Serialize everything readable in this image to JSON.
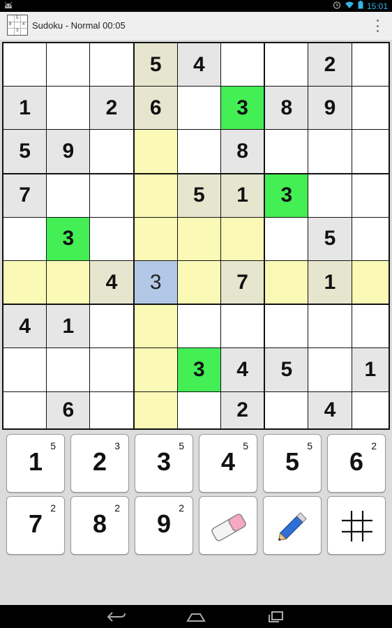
{
  "status_bar": {
    "time": "15:01",
    "icons": [
      "android-icon",
      "alarm-icon",
      "wifi-icon",
      "battery-icon"
    ]
  },
  "app_bar": {
    "title": "Sudoku  -  Normal   00:05",
    "icon_digits": [
      "5",
      "8",
      "4",
      "3"
    ]
  },
  "colors": {
    "white": "#ffffff",
    "given": "#e6e6e6",
    "highlight": "#fafab6",
    "highlight_given": "#e6e6cf",
    "match": "#44ee55",
    "selected": "#b3c8e6"
  },
  "board": {
    "rows": [
      [
        "",
        "",
        "",
        "5",
        "4",
        "",
        "",
        "2",
        ""
      ],
      [
        "1",
        "",
        "2",
        "6",
        "",
        "3",
        "8",
        "9",
        ""
      ],
      [
        "5",
        "9",
        "",
        "",
        "",
        "8",
        "",
        "",
        ""
      ],
      [
        "7",
        "",
        "",
        "",
        "5",
        "1",
        "3",
        "",
        ""
      ],
      [
        "",
        "3",
        "",
        "",
        "",
        "",
        "",
        "5",
        ""
      ],
      [
        "",
        "",
        "4",
        "3",
        "",
        "7",
        "",
        "1",
        ""
      ],
      [
        "4",
        "1",
        "",
        "",
        "",
        "",
        "",
        "",
        ""
      ],
      [
        "",
        "",
        "",
        "",
        "3",
        "4",
        "5",
        "",
        "1"
      ],
      [
        "",
        "6",
        "",
        "",
        "",
        "2",
        "",
        "4",
        ""
      ]
    ],
    "shades": [
      [
        "w",
        "w",
        "w",
        "hg",
        "g",
        "w",
        "w",
        "g",
        "w"
      ],
      [
        "g",
        "w",
        "g",
        "hg",
        "w",
        "m",
        "g",
        "g",
        "w"
      ],
      [
        "g",
        "g",
        "w",
        "h",
        "w",
        "g",
        "w",
        "w",
        "w"
      ],
      [
        "g",
        "w",
        "w",
        "h",
        "hg",
        "hg",
        "m",
        "w",
        "w"
      ],
      [
        "w",
        "m",
        "w",
        "h",
        "h",
        "h",
        "w",
        "g",
        "w"
      ],
      [
        "h",
        "h",
        "hg",
        "s",
        "h",
        "hg",
        "h",
        "hg",
        "h"
      ],
      [
        "g",
        "g",
        "w",
        "h",
        "w",
        "w",
        "w",
        "w",
        "w"
      ],
      [
        "w",
        "w",
        "w",
        "h",
        "m",
        "g",
        "g",
        "w",
        "g"
      ],
      [
        "w",
        "g",
        "w",
        "h",
        "w",
        "g",
        "w",
        "g",
        "w"
      ]
    ]
  },
  "keypad": [
    {
      "type": "digit",
      "digit": "1",
      "count": "5"
    },
    {
      "type": "digit",
      "digit": "2",
      "count": "3"
    },
    {
      "type": "digit",
      "digit": "3",
      "count": "5"
    },
    {
      "type": "digit",
      "digit": "4",
      "count": "5"
    },
    {
      "type": "digit",
      "digit": "5",
      "count": "5"
    },
    {
      "type": "digit",
      "digit": "6",
      "count": "2"
    },
    {
      "type": "digit",
      "digit": "7",
      "count": "2"
    },
    {
      "type": "digit",
      "digit": "8",
      "count": "2"
    },
    {
      "type": "digit",
      "digit": "9",
      "count": "2"
    },
    {
      "type": "tool",
      "icon": "eraser-icon"
    },
    {
      "type": "tool",
      "icon": "pencil-icon"
    },
    {
      "type": "tool",
      "icon": "grid-icon"
    }
  ],
  "nav_bar": {
    "icons": [
      "back-icon",
      "home-icon",
      "recent-apps-icon"
    ]
  }
}
